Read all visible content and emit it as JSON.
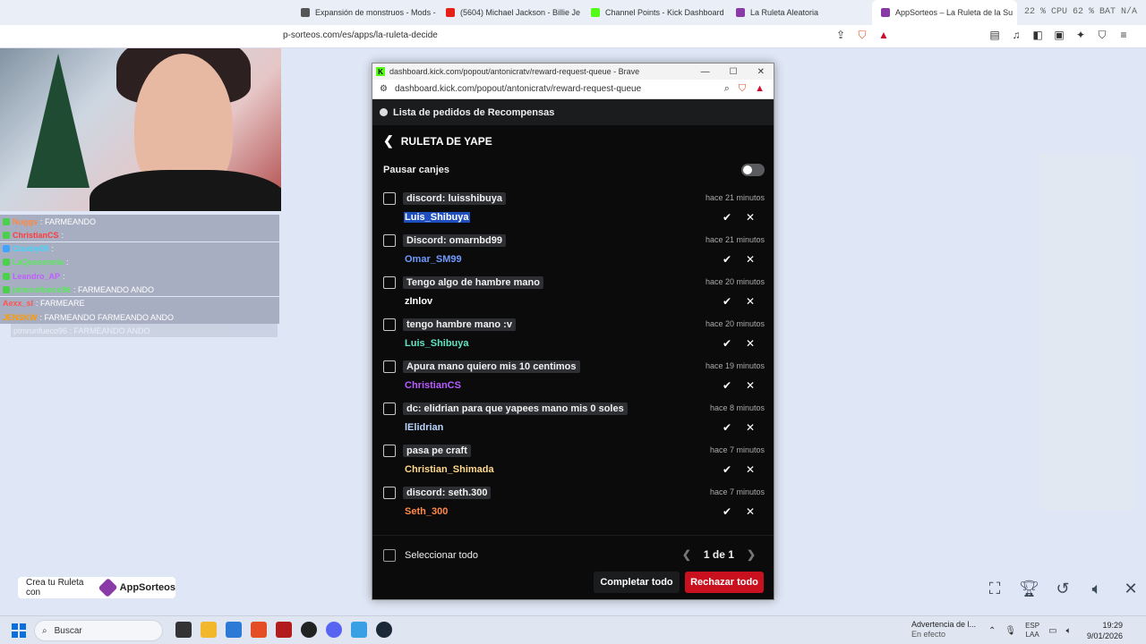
{
  "browser": {
    "tabs": [
      {
        "label": "Expansión de monstruos - Mods - M",
        "color": "#555555"
      },
      {
        "label": "(5604) Michael Jackson - Billie Je",
        "color": "#e62117"
      },
      {
        "label": "Channel Points - Kick Dashboard",
        "color": "#53fc18"
      },
      {
        "label": "La Ruleta Aleatoria",
        "color": "#8a3aa6"
      },
      {
        "label": "AppSorteos – La Ruleta de la Su",
        "color": "#8a3aa6"
      }
    ],
    "stats": "22 % CPU 62 % BAT N/A",
    "address": "p-sorteos.com/es/apps/la-ruleta-decide"
  },
  "chat": [
    {
      "user": "Nuggs",
      "user_color": "#ff8844",
      "message": ": FARMEANDO"
    },
    {
      "user": "ChristianCS",
      "user_color": "#ff3b3b",
      "message": ":"
    },
    {
      "user": "Ctuxby05",
      "user_color": "#3fd4ff",
      "message": ":"
    },
    {
      "user": "LaQuesoneta",
      "user_color": "#59e85b",
      "message": ":"
    },
    {
      "user": "Leandro_AP",
      "user_color": "#c25cff",
      "message": ":"
    },
    {
      "user": "ptmrunfueco96",
      "user_color": "#59e85b",
      "message": ": FARMEANDO ANDO"
    },
    {
      "user": "Aexx_sl",
      "user_color": "#ff5555",
      "message": ": FARMEARE"
    },
    {
      "user": "JENSKW",
      "user_color": "#ff9900",
      "message": ": FARMEANDO  FARMEANDO ANDO"
    }
  ],
  "chat_faded": "ptmrunfueco96 : FARMEANDO ANDO",
  "crea": {
    "text": "Crea tu Ruleta con",
    "brand": "AppSorteos"
  },
  "popup": {
    "window_title": "dashboard.kick.com/popout/antonicratv/reward-request-queue - Brave",
    "address": "dashboard.kick.com/popout/antonicratv/reward-request-queue",
    "header": "Lista de pedidos de Recompensas",
    "reward_title": "RULETA DE YAPE",
    "pause_label": "Pausar canjes",
    "requests": [
      {
        "text": "discord: luisshibuya",
        "time": "hace 21 minutos",
        "user": "Luis_Shibuya",
        "color": "#ffffff"
      },
      {
        "text": "Discord: omarnbd99",
        "time": "hace 21 minutos",
        "user": "Omar_SM99",
        "color": "#6f9bff"
      },
      {
        "text": "Tengo algo de hambre mano",
        "time": "hace 20 minutos",
        "user": "zInlov",
        "color": "#ffffff"
      },
      {
        "text": "tengo hambre mano :v",
        "time": "hace 20 minutos",
        "user": "Luis_Shibuya",
        "color": "#5ee6c4"
      },
      {
        "text": "Apura mano quiero mis 10 centimos",
        "time": "hace 19 minutos",
        "user": "ChristianCS",
        "color": "#b65cff"
      },
      {
        "text": "dc: elidrian para que yapees mano mis 0 soles",
        "time": "hace 8 minutos",
        "user": "lElidrian",
        "color": "#b8d6ff"
      },
      {
        "text": "pasa pe craft",
        "time": "hace 7 minutos",
        "user": "Christian_Shimada",
        "color": "#ffd98a"
      },
      {
        "text": "discord: seth.300",
        "time": "hace 7 minutos",
        "user": "Seth_300",
        "color": "#ff8a4c"
      }
    ],
    "select_all": "Seleccionar todo",
    "pager": "1 de 1",
    "complete_all": "Completar todo",
    "reject_all": "Rechazar todo"
  },
  "taskbar": {
    "search": "Buscar",
    "notification_title": "Advertencia de l...",
    "notification_sub": "En efecto",
    "lang_top": "ESP",
    "lang_bottom": "LAA",
    "time": "19:29",
    "date": "9/01/2026"
  }
}
